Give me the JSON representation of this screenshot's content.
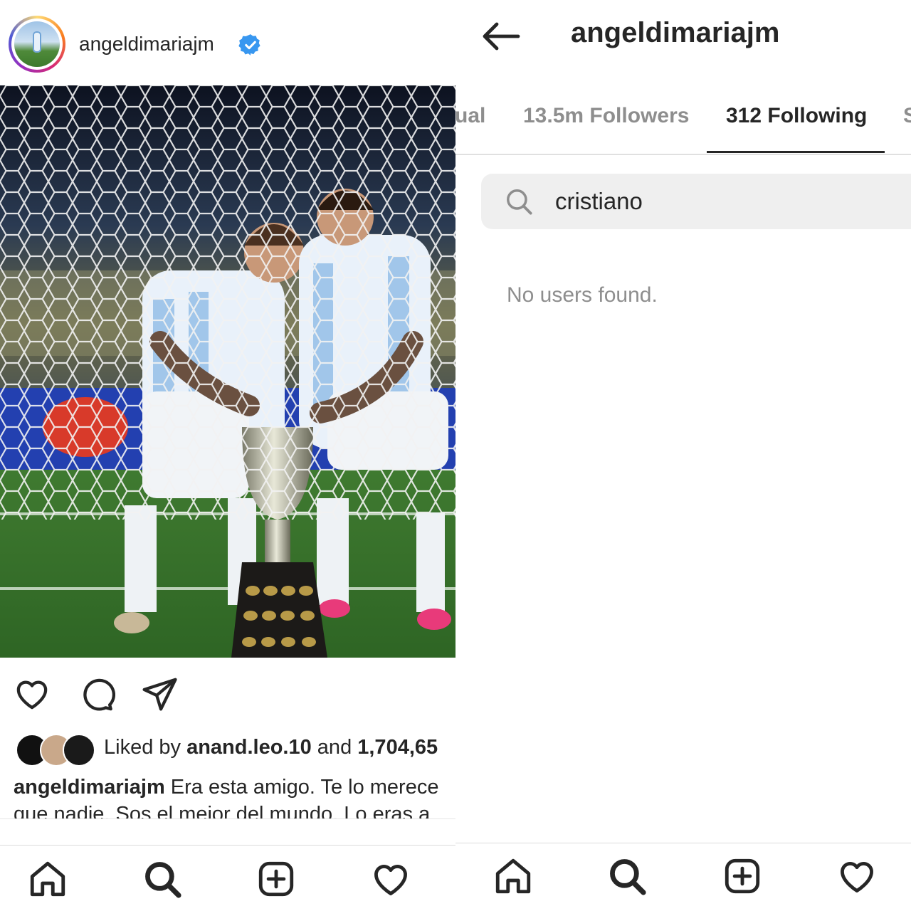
{
  "post": {
    "username": "angeldimariajm",
    "verified_icon": "verified-badge-icon",
    "photo_description_icon": "photo",
    "likes": {
      "prefix": "Liked by ",
      "user": "anand.leo.10",
      "middle": " and ",
      "count": "1,704,65"
    },
    "caption": {
      "username": "angeldimariajm",
      "text": " Era esta amigo. Te lo merece",
      "text_line2": "que nadie. Sos el mejor del mundo. Lo eras a"
    }
  },
  "profile": {
    "title": "angeldimariajm",
    "tabs": [
      {
        "label": "ual",
        "active": false
      },
      {
        "label": "13.5m Followers",
        "active": false
      },
      {
        "label": "312 Following",
        "active": true
      },
      {
        "label": "S",
        "active": false
      }
    ],
    "search": {
      "value": "cristiano"
    },
    "empty_message": "No users found."
  },
  "nav": {
    "items": [
      "home",
      "search",
      "new-post",
      "activity"
    ]
  },
  "colors": {
    "verified": "#3897f0",
    "text": "#262626",
    "muted": "#8e8e8e",
    "search_bg": "#efefef"
  }
}
